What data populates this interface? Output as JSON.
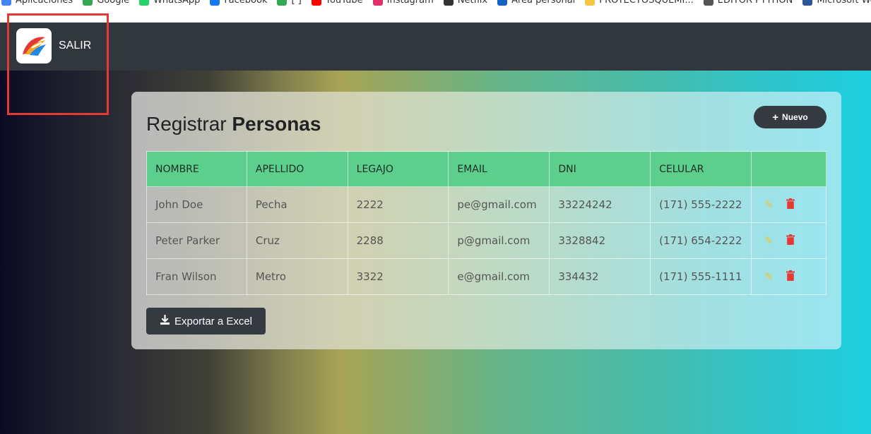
{
  "bookmarks": [
    {
      "label": "Aplicaciones",
      "color": "#4285f4"
    },
    {
      "label": "Google",
      "color": "#34a853"
    },
    {
      "label": "WhatsApp",
      "color": "#25d366"
    },
    {
      "label": "Facebook",
      "color": "#1877f2"
    },
    {
      "label": "[ ]",
      "color": "#34a853"
    },
    {
      "label": "YouTube",
      "color": "#ff0000"
    },
    {
      "label": "Instagram",
      "color": "#e1306c"
    },
    {
      "label": "Netflix",
      "color": "#333333"
    },
    {
      "label": "Área personal",
      "color": "#1565c0"
    },
    {
      "label": "PROYECTOSQUEMI...",
      "color": "#f6c544"
    },
    {
      "label": "EDITOR PYTHON",
      "color": "#555555"
    },
    {
      "label": "Microsoft Word",
      "color": "#2b579a"
    }
  ],
  "navbar": {
    "logo_icon": "app-logo-icon",
    "exit_label": "SALIR"
  },
  "card": {
    "title_light": "Registrar ",
    "title_bold": "Personas",
    "new_button": {
      "icon": "plus-icon",
      "label": "Nuevo"
    },
    "export_button": {
      "icon": "download-icon",
      "label": "Exportar a Excel"
    }
  },
  "table": {
    "headers": [
      "NOMBRE",
      "APELLIDO",
      "LEGAJO",
      "EMAIL",
      "DNI",
      "CELULAR",
      ""
    ],
    "rows": [
      {
        "nombre": "John Doe",
        "apellido": "Pecha",
        "legajo": "2222",
        "email": "pe@gmail.com",
        "dni": "33224242",
        "celular": "(171) 555-2222"
      },
      {
        "nombre": "Peter Parker",
        "apellido": "Cruz",
        "legajo": "2288",
        "email": "p@gmail.com",
        "dni": "3328842",
        "celular": "(171) 654-2222"
      },
      {
        "nombre": "Fran Wilson",
        "apellido": "Metro",
        "legajo": "3322",
        "email": "e@gmail.com",
        "dni": "334432",
        "celular": "(171) 555-1111"
      }
    ]
  },
  "colors": {
    "header_green": "#5ccf8f",
    "edit_icon": "#f0c23a",
    "delete_icon": "#e53935",
    "dark_button": "#343a40",
    "highlight_red": "#e53935"
  }
}
